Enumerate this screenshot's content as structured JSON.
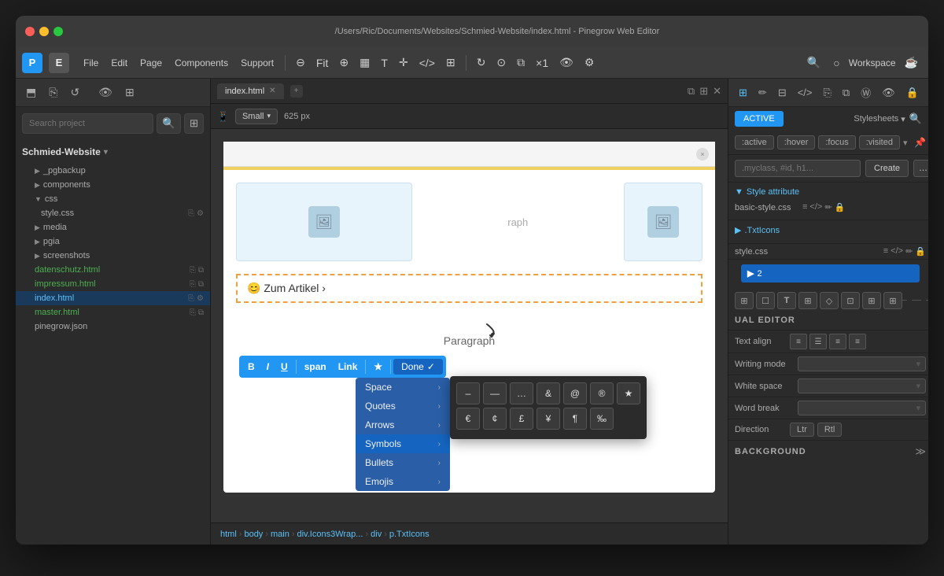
{
  "window": {
    "title": "/Users/Ric/Documents/Websites/Schmied-Website/index.html - Pinegrow Web Editor",
    "traffic_lights": [
      "close",
      "minimize",
      "maximize"
    ]
  },
  "toolbar": {
    "logo1": "P",
    "logo2": "E",
    "menus": [
      "File",
      "Edit",
      "Page",
      "Components",
      "Support"
    ],
    "workspace_label": "Workspace",
    "fit_label": "Fit",
    "counter": "×1"
  },
  "secondary_toolbar": {
    "icons": [
      "upload",
      "copy",
      "undo",
      "eye",
      "grid"
    ]
  },
  "sidebar": {
    "search_placeholder": "Search project",
    "project_name": "Schmied-Website",
    "items": [
      {
        "label": "_pgbackup",
        "type": "folder",
        "indent": 1,
        "arrow": "▶"
      },
      {
        "label": "components",
        "type": "folder",
        "indent": 1,
        "arrow": "▶"
      },
      {
        "label": "css",
        "type": "folder-open",
        "indent": 1,
        "arrow": "▼"
      },
      {
        "label": "style.css",
        "type": "file",
        "indent": 2
      },
      {
        "label": "media",
        "type": "folder",
        "indent": 1,
        "arrow": "▶"
      },
      {
        "label": "pgia",
        "type": "folder",
        "indent": 1,
        "arrow": "▶"
      },
      {
        "label": "screenshots",
        "type": "folder",
        "indent": 1,
        "arrow": "▶"
      },
      {
        "label": "datenschutz.html",
        "type": "file",
        "indent": 1
      },
      {
        "label": "impressum.html",
        "type": "file",
        "indent": 1
      },
      {
        "label": "index.html",
        "type": "file",
        "indent": 1,
        "active": true
      },
      {
        "label": "master.html",
        "type": "file",
        "indent": 1
      },
      {
        "label": "pinegrow.json",
        "type": "file",
        "indent": 1
      }
    ]
  },
  "canvas": {
    "tab_label": "index.html",
    "viewport_label": "Small",
    "viewport_width": "625 px"
  },
  "text_toolbar": {
    "buttons": [
      "B",
      "I",
      "U",
      "span",
      "Link",
      "★"
    ],
    "done_label": "Done"
  },
  "dropdown": {
    "items": [
      {
        "label": "Space",
        "has_arrow": true
      },
      {
        "label": "Quotes",
        "has_arrow": true
      },
      {
        "label": "Arrows",
        "has_arrow": true
      },
      {
        "label": "Symbols",
        "has_arrow": true,
        "active": true
      },
      {
        "label": "Bullets",
        "has_arrow": true
      },
      {
        "label": "Emojis",
        "has_arrow": true
      }
    ]
  },
  "symbols_submenu": {
    "row1": [
      "–",
      "—",
      "…",
      "&",
      "@",
      "®",
      "★"
    ],
    "row2": [
      "€",
      "¢",
      "£",
      "¥",
      "¶",
      "‰"
    ]
  },
  "webpage": {
    "paragraph_label": "Paragraph",
    "selected_text": "😊 Zum Artikel ›",
    "close_btn": "×"
  },
  "breadcrumb": {
    "items": [
      "html",
      "body",
      "main",
      "div.Icons3Wrap...",
      "div",
      "p.TxtIcons"
    ]
  },
  "right_panel": {
    "tabs": {
      "active_label": "ACTIVE",
      "stylesheets_label": "Stylesheets"
    },
    "pseudo_classes": [
      ":active",
      ":hover",
      ":focus",
      ":visited"
    ],
    "selector_placeholder": ".myclass, #id, h1...",
    "create_btn": "Create",
    "style_attribute": {
      "label": "Style attribute",
      "file": "basic-style.css"
    },
    "txticons_label": ".TxtIcons",
    "style_css_label": "style.css",
    "active_number": "2",
    "visual_editor": {
      "title": "UAL EDITOR",
      "text_align_label": "Text align",
      "text_align_options": [
        "left",
        "center",
        "right",
        "justify"
      ],
      "writing_mode_label": "Writing mode",
      "white_space_label": "White space",
      "word_break_label": "Word break",
      "direction_label": "Direction",
      "direction_options": [
        "Ltr",
        "Rtl"
      ]
    },
    "background": {
      "title": "BACKGROUND"
    }
  }
}
